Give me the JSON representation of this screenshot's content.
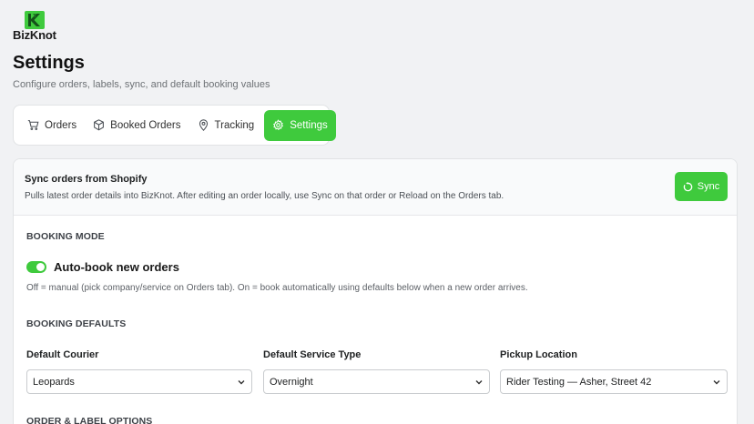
{
  "brand": {
    "name": "BizKnot"
  },
  "header": {
    "title": "Settings",
    "subtitle": "Configure orders, labels, sync, and default booking values"
  },
  "tabs": [
    {
      "label": "Orders",
      "icon": "cart-icon"
    },
    {
      "label": "Booked Orders",
      "icon": "box-icon"
    },
    {
      "label": "Tracking",
      "icon": "map-pin-icon"
    },
    {
      "label": "Settings",
      "icon": "gear-icon",
      "active": true
    }
  ],
  "sync": {
    "title": "Sync orders from Shopify",
    "description": "Pulls latest order details into BizKnot. After editing an order locally, use Sync on that order or Reload on the Orders tab.",
    "button_label": "Sync"
  },
  "booking_mode": {
    "heading": "BOOKING MODE",
    "toggle_label": "Auto-book new orders",
    "toggle_on": true,
    "description": "Off = manual (pick company/service on Orders tab). On = book automatically using defaults below when a new order arrives."
  },
  "booking_defaults": {
    "heading": "BOOKING DEFAULTS",
    "courier": {
      "label": "Default Courier",
      "value": "Leopards"
    },
    "service": {
      "label": "Default Service Type",
      "value": "Overnight"
    },
    "pickup": {
      "label": "Pickup Location",
      "value": "Rider Testing — Asher, Street 42"
    }
  },
  "order_label_options": {
    "heading": "ORDER & LABEL OPTIONS"
  },
  "colors": {
    "accent": "#3fca3d",
    "background": "#f1f2f4"
  }
}
